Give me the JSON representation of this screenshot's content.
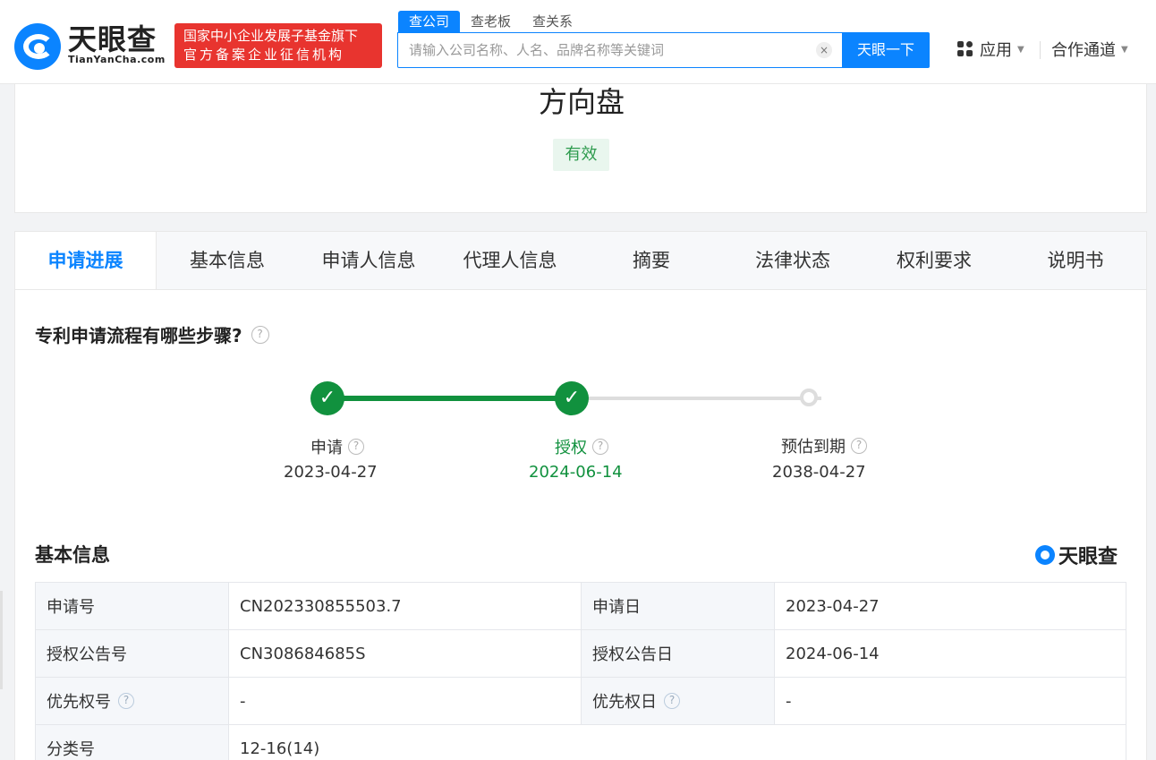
{
  "header": {
    "logo_text": "天眼查",
    "logo_sub": "TianYanCha.com",
    "banner_line1": "国家中小企业发展子基金旗下",
    "banner_line2": "官方备案企业征信机构",
    "search_tabs": [
      "查公司",
      "查老板",
      "查关系"
    ],
    "search_placeholder": "请输入公司名称、人名、品牌名称等关键词",
    "clear_icon": "×",
    "search_button": "天眼一下",
    "nav_apps": "应用",
    "nav_coop": "合作通道"
  },
  "patent": {
    "name": "方向盘",
    "status": "有效"
  },
  "tabs": [
    "申请进展",
    "基本信息",
    "申请人信息",
    "代理人信息",
    "摘要",
    "法律状态",
    "权利要求",
    "说明书"
  ],
  "process": {
    "title": "专利申请流程有哪些步骤?",
    "steps": [
      {
        "label": "申请",
        "date": "2023-04-27"
      },
      {
        "label": "授权",
        "date": "2024-06-14"
      },
      {
        "label": "预估到期",
        "date": "2038-04-27"
      }
    ]
  },
  "basic_info": {
    "title": "基本信息",
    "brand": "天眼查",
    "rows": [
      {
        "label1": "申请号",
        "value1": "CN202330855503.7",
        "label2": "申请日",
        "value2": "2023-04-27"
      },
      {
        "label1": "授权公告号",
        "value1": "CN308684685S",
        "label2": "授权公告日",
        "value2": "2024-06-14"
      },
      {
        "label1": "优先权号",
        "value1": "-",
        "label2": "优先权日",
        "value2": "-"
      },
      {
        "label1": "分类号",
        "value1": "12-16(14)"
      }
    ]
  },
  "icons": {
    "help": "?",
    "check": "✓",
    "caret": "▼"
  },
  "colors": {
    "brand_blue": "#0b84ff",
    "banner_red": "#e8342f",
    "success_green": "#11913e"
  }
}
